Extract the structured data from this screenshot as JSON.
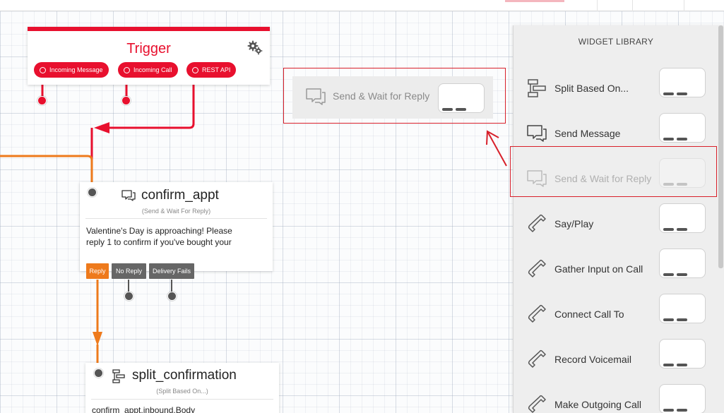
{
  "trigger": {
    "title": "Trigger",
    "pills": [
      "Incoming Message",
      "Incoming Call",
      "REST API"
    ]
  },
  "confirm_node": {
    "title": "confirm_appt",
    "subtitle": "(Send & Wait For Reply)",
    "body_line1": "Valentine's Day is approaching! Please",
    "body_line2": "reply 1 to confirm if you've bought your",
    "tags": [
      "Reply",
      "No Reply",
      "Delivery Fails"
    ]
  },
  "split_node": {
    "title": "split_confirmation",
    "subtitle": "(Split Based On...)",
    "body": "confirm_appt.inbound.Body"
  },
  "dragging_widget": {
    "label": "Send & Wait for Reply"
  },
  "library": {
    "title": "WIDGET LIBRARY",
    "items": [
      {
        "label": "Split Based On...",
        "icon": "split-icon"
      },
      {
        "label": "Send Message",
        "icon": "chat-icon"
      },
      {
        "label": "Send & Wait for Reply",
        "icon": "chat-icon"
      },
      {
        "label": "Say/Play",
        "icon": "phone-icon"
      },
      {
        "label": "Gather Input on Call",
        "icon": "phone-icon"
      },
      {
        "label": "Connect Call To",
        "icon": "phone-icon"
      },
      {
        "label": "Record Voicemail",
        "icon": "phone-icon"
      },
      {
        "label": "Make Outgoing Call",
        "icon": "phone-icon"
      }
    ]
  },
  "colors": {
    "brand_red": "#e8102e",
    "wire_orange": "#ee7a1c",
    "annotation_red": "#d8202a"
  }
}
